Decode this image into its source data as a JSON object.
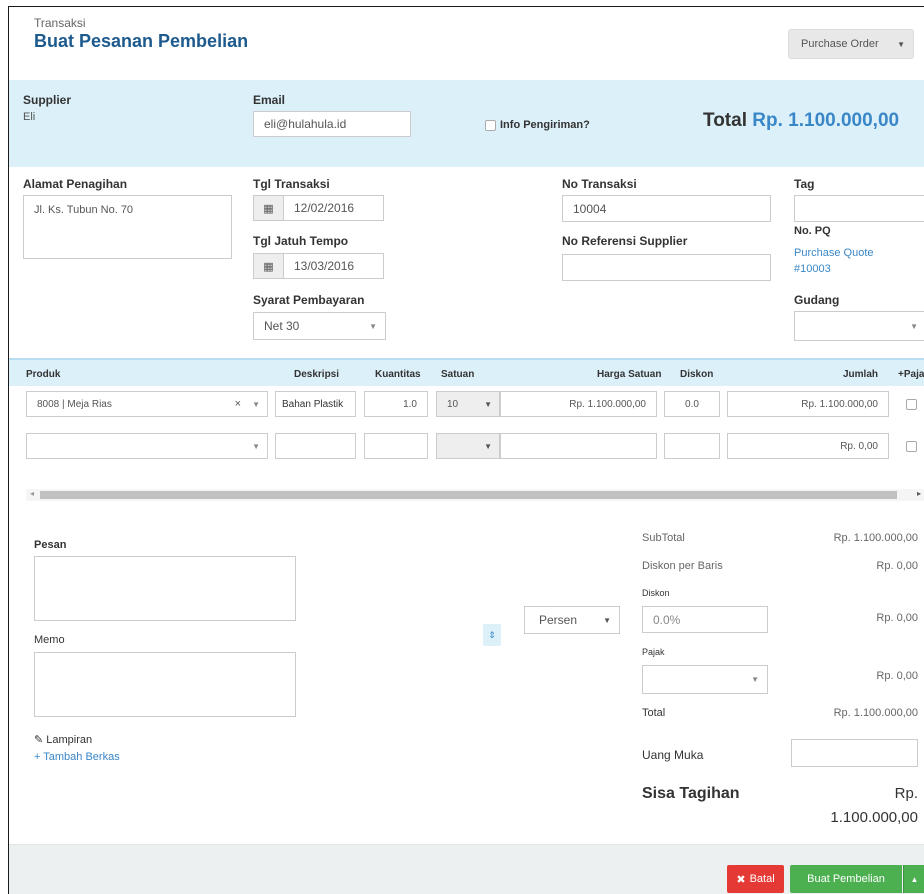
{
  "header": {
    "breadcrumb": "Transaksi",
    "title": "Buat Pesanan Pembelian",
    "type_select": "Purchase Order"
  },
  "supplier_bar": {
    "supplier_label": "Supplier",
    "supplier_value": "Eli",
    "email_label": "Email",
    "email_value": "eli@hulahula.id",
    "shipping_label": "Info Pengiriman?",
    "total_label": "Total",
    "total_value": "Rp. 1.100.000,00"
  },
  "form": {
    "billing_label": "Alamat Penagihan",
    "billing_value": "Jl. Ks. Tubun No. 70",
    "trx_date_label": "Tgl Transaksi",
    "trx_date_value": "12/02/2016",
    "due_date_label": "Tgl Jatuh Tempo",
    "due_date_value": "13/03/2016",
    "terms_label": "Syarat Pembayaran",
    "terms_value": "Net 30",
    "trx_no_label": "No Transaksi",
    "trx_no_value": "10004",
    "supplier_ref_label": "No Referensi Supplier",
    "supplier_ref_value": "",
    "tag_label": "Tag",
    "pq_label": "No. PQ",
    "pq_link": "Purchase Quote #10003",
    "warehouse_label": "Gudang"
  },
  "table": {
    "headers": {
      "product": "Produk",
      "description": "Deskripsi",
      "quantity": "Kuantitas",
      "unit": "Satuan",
      "unit_price": "Harga Satuan",
      "discount": "Diskon",
      "amount": "Jumlah",
      "tax": "+Paja"
    },
    "rows": [
      {
        "product": "8008 | Meja Rias",
        "description": "Bahan Plastik",
        "quantity": "1.0",
        "unit": "10",
        "unit_price": "Rp. 1.100.000,00",
        "discount": "0.0",
        "amount": "Rp. 1.100.000,00"
      },
      {
        "product": "",
        "description": "",
        "quantity": "",
        "unit": "",
        "unit_price": "",
        "discount": "",
        "amount": "Rp. 0,00"
      }
    ]
  },
  "notes": {
    "message_label": "Pesan",
    "memo_label": "Memo",
    "attachment_label": "Lampiran",
    "add_file_link": "+ Tambah Berkas"
  },
  "summary": {
    "subtotal_label": "SubTotal",
    "subtotal_value": "Rp. 1.100.000,00",
    "line_discount_label": "Diskon per Baris",
    "line_discount_value": "Rp. 0,00",
    "discount_label": "Diskon",
    "discount_type": "Persen",
    "discount_input": "0.0%",
    "discount_value": "Rp. 0,00",
    "tax_label": "Pajak",
    "tax_value": "Rp. 0,00",
    "total_label": "Total",
    "total_value": "Rp. 1.100.000,00",
    "down_payment_label": "Uang Muka",
    "balance_label": "Sisa Tagihan",
    "balance_currency": "Rp.",
    "balance_value": "1.100.000,00"
  },
  "footer": {
    "cancel_label": "Batal",
    "submit_label": "Buat Pembelian"
  },
  "colors": {
    "header_title": "#1d5a8e",
    "info_bar_bg": "#dcf0fa",
    "link": "#3a87c8",
    "cancel_btn": "#e53935",
    "submit_btn": "#4caf50"
  }
}
